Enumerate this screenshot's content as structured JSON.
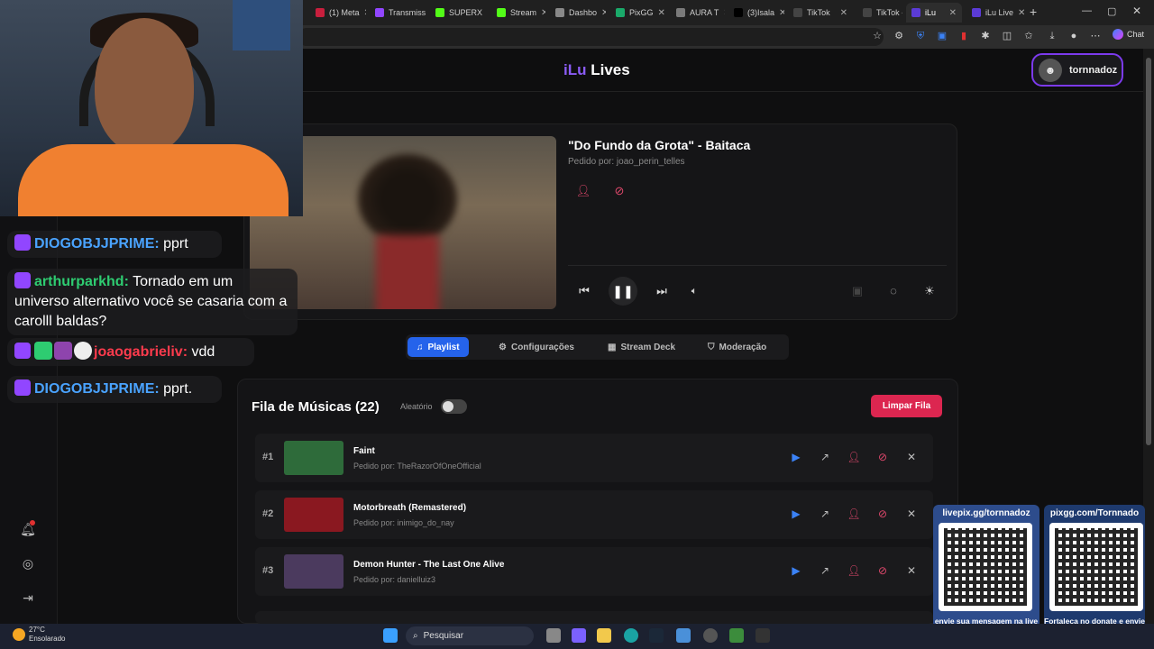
{
  "browser": {
    "tabs": [
      {
        "label": "(1) Meta",
        "color": "#c81f3d"
      },
      {
        "label": "Transmiss",
        "color": "#9146ff"
      },
      {
        "label": "SUPERX",
        "color": "#53fc18"
      },
      {
        "label": "Stream",
        "color": "#53fc18"
      },
      {
        "label": "Dashbo",
        "color": "#888888"
      },
      {
        "label": "PixGG",
        "color": "#1aaa6a"
      },
      {
        "label": "AURA T",
        "color": "#7a7a7a"
      },
      {
        "label": "(3)Isala",
        "color": "#000000"
      },
      {
        "label": "TikTok",
        "color": "#444444"
      },
      {
        "label": "TikTok -",
        "color": "#444444"
      },
      {
        "label": "iLu",
        "color": "#5b3bd6"
      },
      {
        "label": "iLu Live",
        "color": "#5b3bd6"
      }
    ],
    "chat_button": "Chat"
  },
  "app": {
    "logo_a": "iLu",
    "logo_b": "Lives",
    "username": "tornnadoz"
  },
  "now_playing": {
    "title": "\"Do Fundo da Grota\" - Baitaca",
    "requested_by": "Pedido por: joao_perin_telles"
  },
  "nav": {
    "tabs": [
      {
        "label": "Playlist",
        "icon": "music-note-icon",
        "active": true
      },
      {
        "label": "Configurações",
        "icon": "gear-icon",
        "active": false
      },
      {
        "label": "Stream Deck",
        "icon": "grid-icon",
        "active": false
      },
      {
        "label": "Moderação",
        "icon": "shield-icon",
        "active": false
      }
    ]
  },
  "queue": {
    "title": "Fila de Músicas (22)",
    "shuffle_label": "Aleatório",
    "shuffle_on": false,
    "clear_label": "Limpar Fila",
    "items": [
      {
        "num": "#1",
        "title": "Faint",
        "requested_by": "Pedido por: TheRazorOfOneOfficial",
        "thumb_color": "#2e6b3a"
      },
      {
        "num": "#2",
        "title": "Motorbreath (Remastered)",
        "requested_by": "Pedido por: inimigo_do_nay",
        "thumb_color": "#8a1820"
      },
      {
        "num": "#3",
        "title": "Demon Hunter - The Last One Alive",
        "requested_by": "Pedido por: danielluiz3",
        "thumb_color": "#4b3a5e"
      }
    ]
  },
  "overlay": {
    "chat": [
      {
        "user": "DIOGOBJJPRIME:",
        "text": " pprt",
        "user_color": "#4aa3ff"
      },
      {
        "user": "arthurparkhd:",
        "text": " Tornado em um universo alternativo você se casaria com a carolll baldas?",
        "user_color": "#2ecc71"
      },
      {
        "user": "joaogabrieliv:",
        "text": " vdd",
        "user_color": "#ff3b4d"
      },
      {
        "user": "DIOGOBJJPRIME:",
        "text": " pprt.",
        "user_color": "#4aa3ff"
      }
    ],
    "qr_a_top": "livepix.gg/tornnadoz",
    "qr_a_bottom": "envie sua mensagem na live via pix!",
    "qr_b_top": "pixgg.com/Tornnado",
    "qr_b_bottom": "Fortaleça no donate e envie sua mensagem!"
  },
  "taskbar": {
    "temperature": "27°C",
    "weather": "Ensolarado",
    "search_placeholder": "Pesquisar"
  }
}
